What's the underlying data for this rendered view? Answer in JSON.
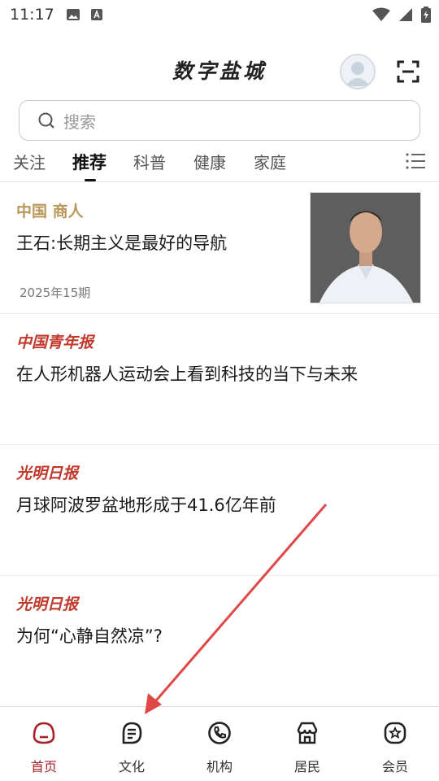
{
  "status_bar": {
    "time": "11:17"
  },
  "header": {
    "app_title": "数字盐城"
  },
  "search": {
    "placeholder": "搜索"
  },
  "tabs": [
    {
      "label": "关注",
      "active": false
    },
    {
      "label": "推荐",
      "active": true
    },
    {
      "label": "科普",
      "active": false
    },
    {
      "label": "健康",
      "active": false
    },
    {
      "label": "家庭",
      "active": false
    }
  ],
  "articles": [
    {
      "source": "中国 商人",
      "title": "王石:长期主义是最好的导航",
      "issue": "2025年15期"
    },
    {
      "source": "中国青年报",
      "title": "在人形机器人运动会上看到科技的当下与未来"
    },
    {
      "source": "光明日报",
      "title": "月球阿波罗盆地形成于41.6亿年前"
    },
    {
      "source": "光明日报",
      "title": "为何“心静自然凉”?"
    }
  ],
  "bottom_nav": [
    {
      "label": "首页",
      "icon": "home-icon",
      "active": true
    },
    {
      "label": "文化",
      "icon": "document-icon",
      "active": false
    },
    {
      "label": "机构",
      "icon": "phone-icon",
      "active": false
    },
    {
      "label": "居民",
      "icon": "shop-icon",
      "active": false
    },
    {
      "label": "会员",
      "icon": "member-star-icon",
      "active": false
    }
  ],
  "colors": {
    "accent": "#a8222a",
    "source_gold": "#b8975a",
    "source_red": "#c0392b",
    "annotation_arrow": "#e04848"
  }
}
